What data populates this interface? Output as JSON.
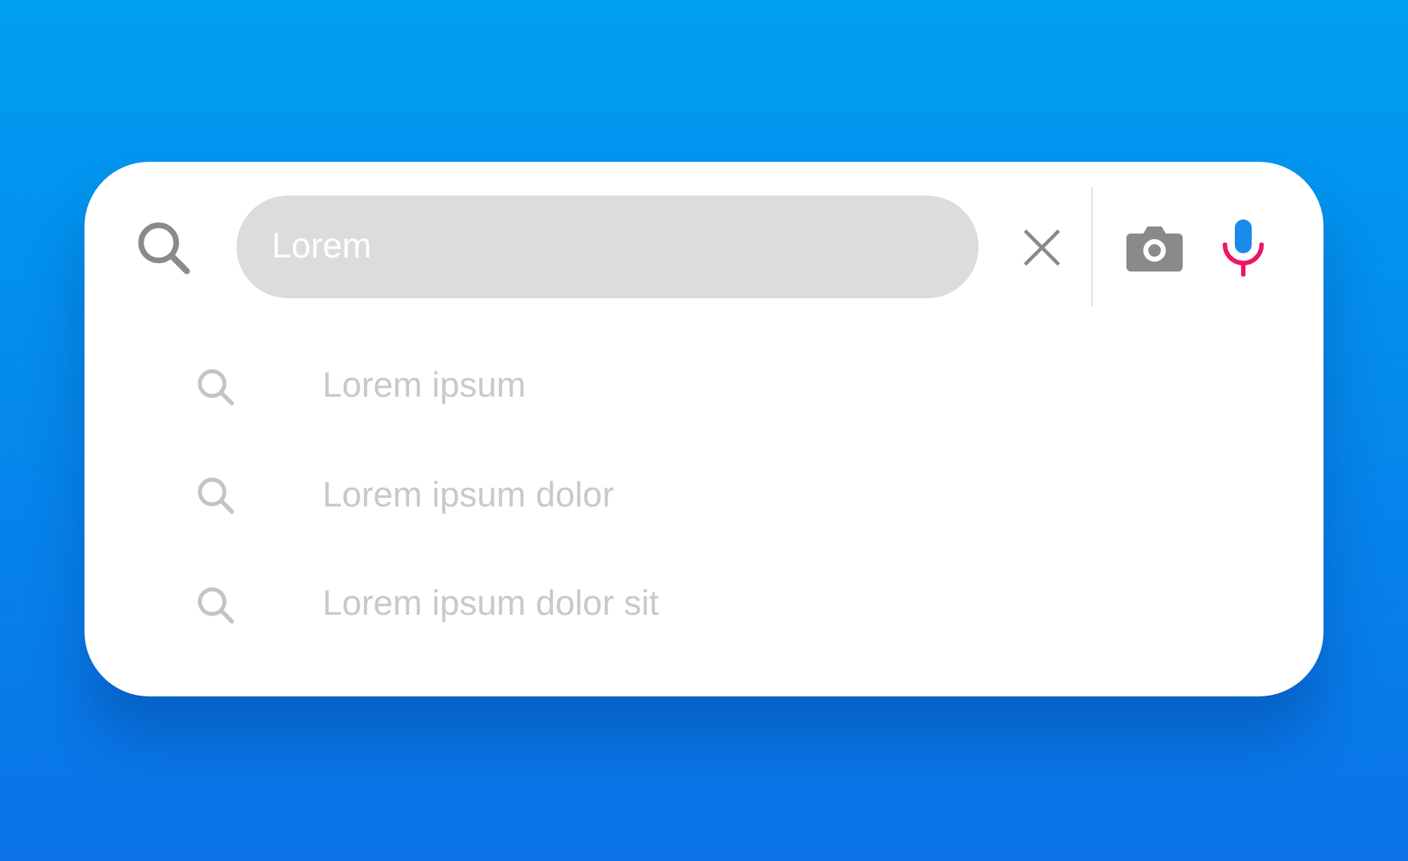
{
  "search": {
    "value": "Lorem"
  },
  "suggestions": [
    {
      "text": "Lorem ipsum"
    },
    {
      "text": "Lorem ipsum dolor"
    },
    {
      "text": "Lorem ipsum dolor sit"
    }
  ]
}
